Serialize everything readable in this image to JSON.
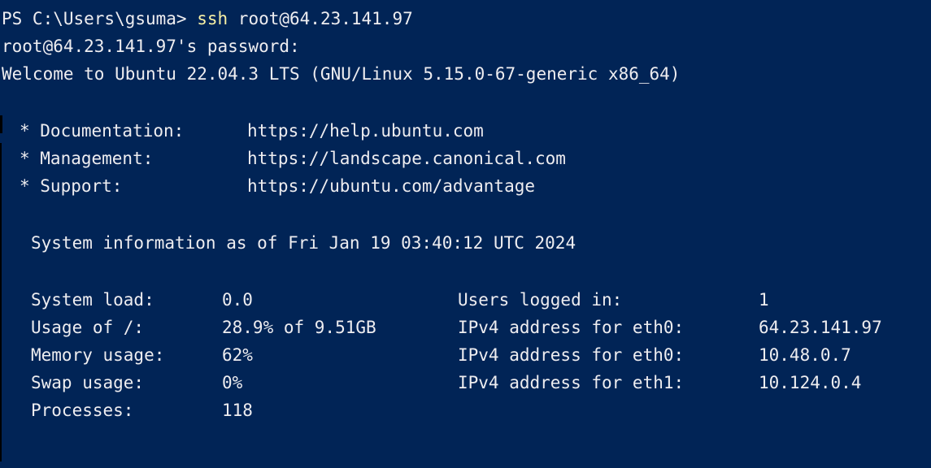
{
  "window": {
    "background": "#012456",
    "foreground": "#eeedf0",
    "accent_command": "#f9f1a5"
  },
  "prompt": {
    "path": "PS C:\\Users\\gsuma> ",
    "command": "ssh",
    "args": " root@64.23.141.97"
  },
  "auth": {
    "password_prompt": "root@64.23.141.97's password:"
  },
  "welcome": "Welcome to Ubuntu 22.04.3 LTS (GNU/Linux 5.15.0-67-generic x86_64)",
  "links": [
    {
      "key": "* Documentation:",
      "url": "https://help.ubuntu.com"
    },
    {
      "key": "* Management:",
      "url": "https://landscape.canonical.com"
    },
    {
      "key": "* Support:",
      "url": "https://ubuntu.com/advantage"
    }
  ],
  "sysinfo_header": "System information as of Fri Jan 19 03:40:12 UTC 2024",
  "sysinfo": [
    {
      "label": "System load:",
      "value": "0.0",
      "label2": "Users logged in:",
      "value2": "1"
    },
    {
      "label": "Usage of /:",
      "value": "28.9% of 9.51GB",
      "label2": "IPv4 address for eth0:",
      "value2": "64.23.141.97"
    },
    {
      "label": "Memory usage:",
      "value": "62%",
      "label2": "IPv4 address for eth0:",
      "value2": "10.48.0.7"
    },
    {
      "label": "Swap usage:",
      "value": "0%",
      "label2": "IPv4 address for eth1:",
      "value2": "10.124.0.4"
    },
    {
      "label": "Processes:",
      "value": "118",
      "label2": "",
      "value2": ""
    }
  ]
}
